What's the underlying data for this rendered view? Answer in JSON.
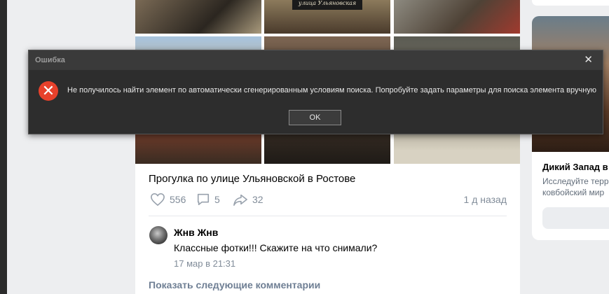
{
  "post": {
    "sign_text": "улица Ульяновская",
    "title": "Прогулка по улице Ульяновской в Ростове",
    "likes": "556",
    "comments": "5",
    "shares": "32",
    "time_ago": "1 д назад"
  },
  "comment": {
    "author": "Жнв Жнв",
    "text": "Классные фотки!!! Скажите на что снимали?",
    "date": "17 мар в 21:31"
  },
  "more_comments_label": "Показать следующие комментарии",
  "ad": {
    "title": "Дикий Запад в W",
    "description": "Исследуйте терр\nковбойский мир"
  },
  "dialog": {
    "title": "Ошибка",
    "message": "Не получилось найти элемент по автоматически сгенерированным условиям поиска. Попробуйте задать параметры для поиска элемента вручную",
    "ok_label": "OK",
    "close_glyph": "✕",
    "error_glyph": "✕"
  },
  "colors": {
    "page_bg": "#edeef0",
    "dialog_bg": "#2d2d2d",
    "error_red": "#e8412b",
    "meta_gray": "#818c99"
  }
}
